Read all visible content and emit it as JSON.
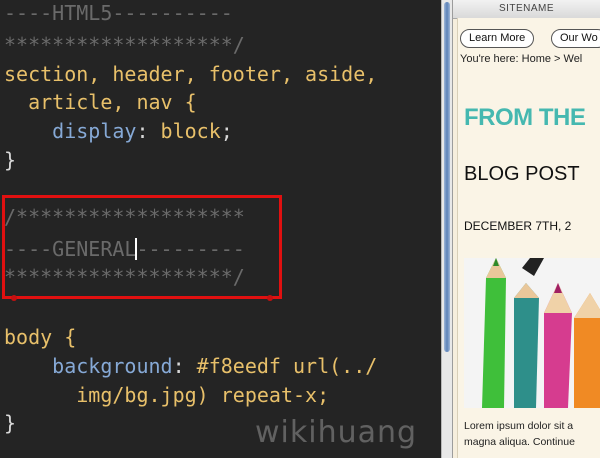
{
  "editor": {
    "line1": "----HTML5----------",
    "line2": "*******************/",
    "sel_line1": "section, header, footer, aside,",
    "sel_line2": "  article, nav {",
    "prop1": "    display",
    "colon1": ": ",
    "val1": "block",
    "semi1": ";",
    "close1": "}",
    "general_line1": "/*******************",
    "general_prefix": "----GENERAL",
    "general_suffix": "---------",
    "general_line3": "*******************/",
    "body_sel": "body {",
    "prop2": "    background",
    "colon2": ": ",
    "val2a": "#f8eedf url(../",
    "val2b": "      img/bg.jpg) repeat-x;",
    "close2": "}"
  },
  "browser": {
    "sitename": "SITENAME",
    "learn_more": "Learn More",
    "our_work": "Our Wo",
    "breadcrumb": "You're here: Home > Wel",
    "banner": "FROM THE",
    "post_title": "BLOG POST",
    "post_date": "DECEMBER 7TH, 2",
    "lorem1": "Lorem ipsum dolor sit a",
    "lorem2": "magna aliqua. Continue"
  },
  "watermark": "wikihuang"
}
